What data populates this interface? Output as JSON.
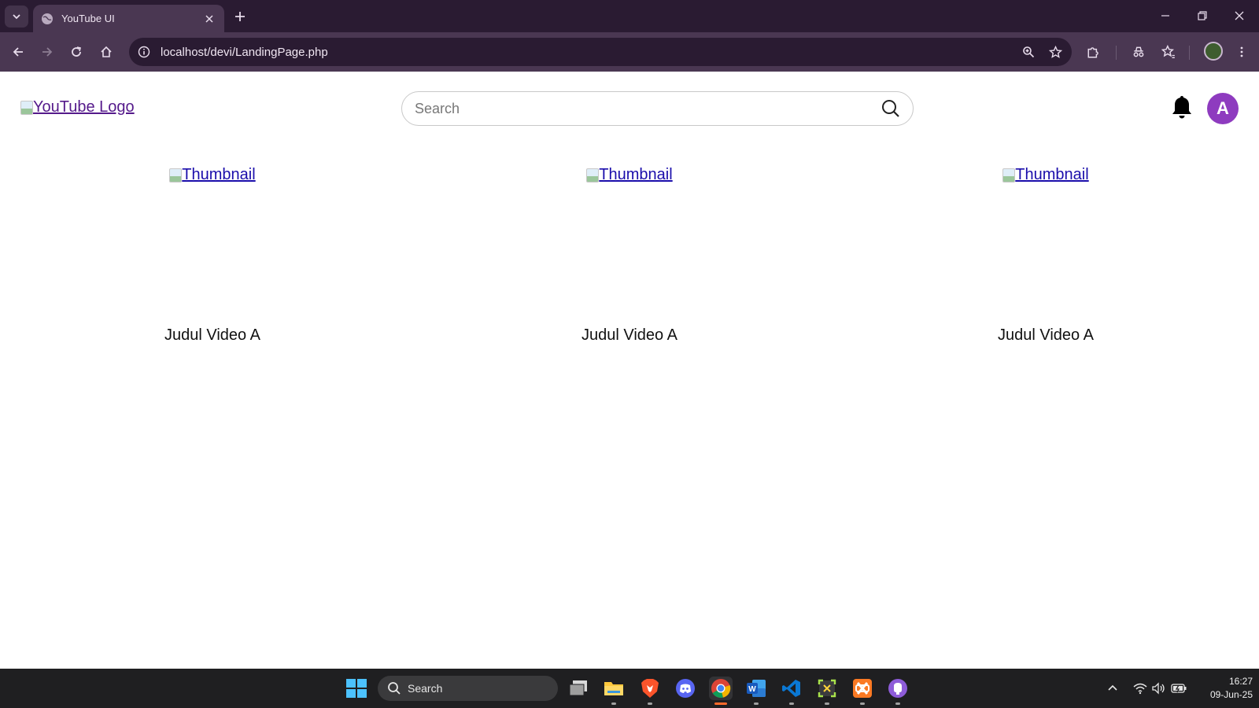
{
  "browser": {
    "tab": {
      "title": "YouTube UI"
    },
    "url": "localhost/devi/LandingPage.php"
  },
  "header": {
    "logo_alt": "YouTube Logo",
    "search": {
      "placeholder": "Search",
      "value": ""
    },
    "avatar_initial": "A",
    "avatar_color": "#8e3bbf"
  },
  "videos": [
    {
      "thumbnail_alt": "Thumbnail",
      "title": "Judul Video A"
    },
    {
      "thumbnail_alt": "Thumbnail",
      "title": "Judul Video A"
    },
    {
      "thumbnail_alt": "Thumbnail",
      "title": "Judul Video A"
    }
  ],
  "taskbar": {
    "search_label": "Search",
    "apps": [
      "task-view",
      "file-explorer",
      "brave",
      "discord",
      "chrome",
      "word",
      "vs-code",
      "snipping-tool",
      "xampp",
      "github-desktop"
    ],
    "time": "16:27",
    "date": "09-Jun-25"
  }
}
